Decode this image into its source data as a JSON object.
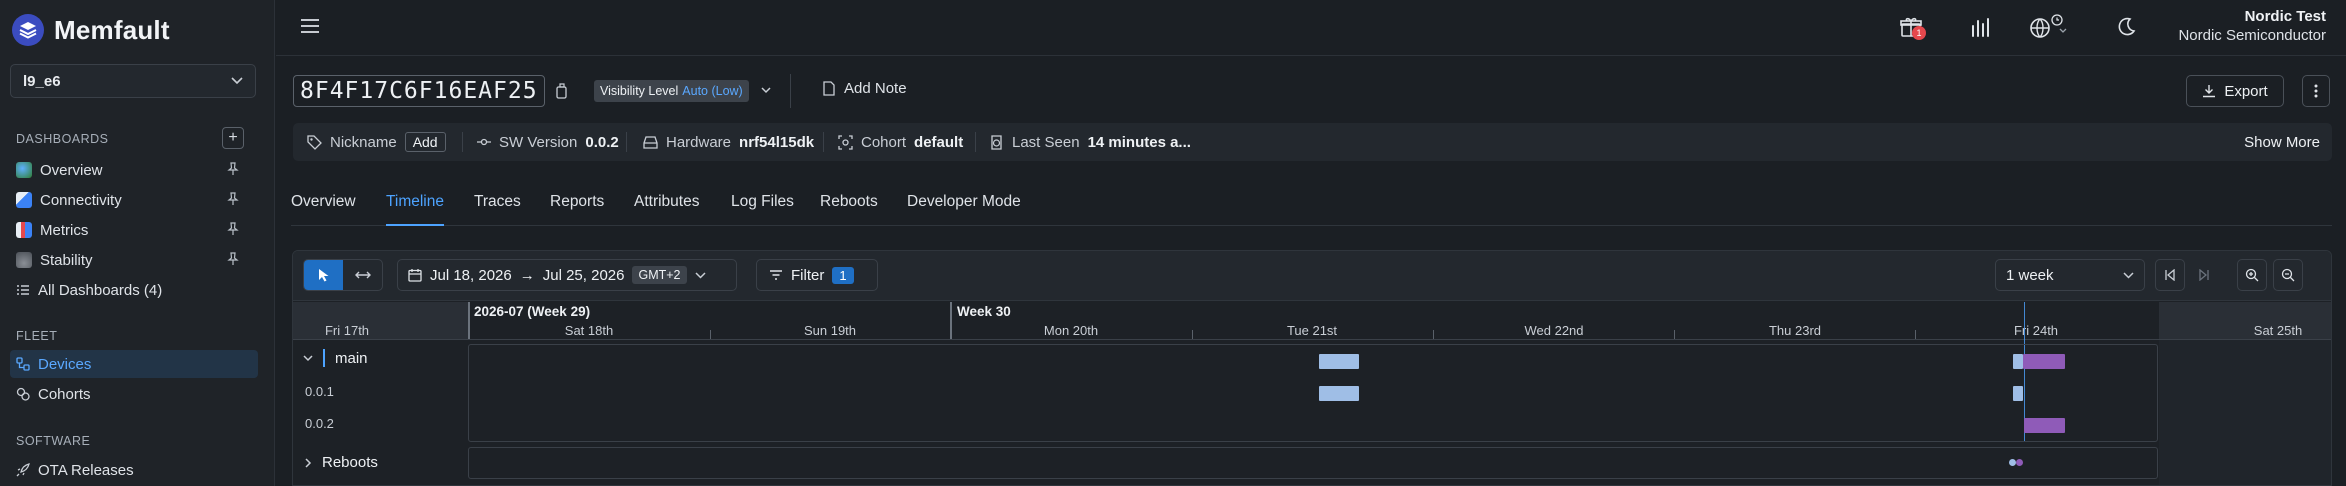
{
  "brand": {
    "name": "Memfault"
  },
  "project": {
    "name": "l9_e6"
  },
  "sidebar": {
    "dashboards_label": "DASHBOARDS",
    "dashboards": [
      {
        "label": "Overview",
        "icon": "globe-emoji-icon"
      },
      {
        "label": "Connectivity",
        "icon": "chart-emoji-icon"
      },
      {
        "label": "Metrics",
        "icon": "bar-chart-emoji-icon"
      },
      {
        "label": "Stability",
        "icon": "rock-emoji-icon"
      }
    ],
    "all_dashboards": "All Dashboards (4)",
    "fleet_label": "FLEET",
    "fleet": [
      {
        "label": "Devices"
      },
      {
        "label": "Cohorts"
      }
    ],
    "software_label": "SOFTWARE",
    "software": [
      {
        "label": "OTA Releases"
      }
    ]
  },
  "topbar": {
    "gift_badge": "1",
    "user_name": "Nordic Test",
    "user_org": "Nordic Semiconductor"
  },
  "device": {
    "serial": "8F4F17C6F16EAF25",
    "visibility_label": "Visibility Level",
    "visibility_value": "Auto (Low)",
    "add_note": "Add Note",
    "export": "Export",
    "meta": {
      "nickname_label": "Nickname",
      "nickname_add": "Add",
      "sw_label": "SW Version",
      "sw_value": "0.0.2",
      "hw_label": "Hardware",
      "hw_value": "nrf54l15dk",
      "cohort_label": "Cohort",
      "cohort_value": "default",
      "last_seen_label": "Last Seen",
      "last_seen_value": "14 minutes a...",
      "show_more": "Show More"
    }
  },
  "tabs": [
    "Overview",
    "Timeline",
    "Traces",
    "Reports",
    "Attributes",
    "Log Files",
    "Reboots",
    "Developer Mode"
  ],
  "active_tab": "Timeline",
  "timeline": {
    "range_start": "Jul 18, 2026",
    "range_end": "Jul 25, 2026",
    "timezone": "GMT+2",
    "filter_label": "Filter",
    "filter_count": "1",
    "window": "1 week",
    "week_labels": [
      "2026-07 (Week 29)",
      "Week 30"
    ],
    "days": [
      "Fri 17th",
      "Sat 18th",
      "Sun 19th",
      "Mon 20th",
      "Tue 21st",
      "Wed 22nd",
      "Thu 23rd",
      "Fri 24th",
      "Sat 25th"
    ],
    "group_name": "main",
    "rows": [
      "0.0.1",
      "0.0.2"
    ],
    "reboots_label": "Reboots",
    "colors": {
      "v001": "#9fbee6",
      "v002": "#8f5bb8",
      "accent": "#4da3ff"
    }
  }
}
